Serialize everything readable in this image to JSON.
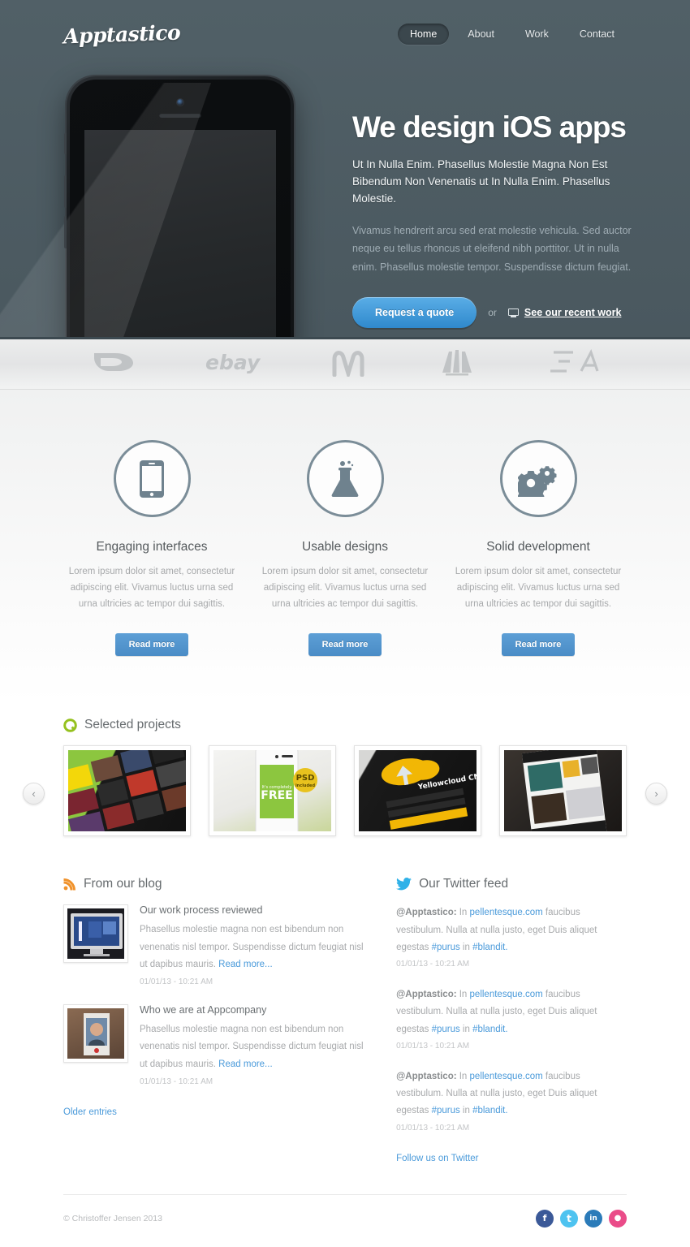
{
  "brand": {
    "logo_text": "Apptastico"
  },
  "nav": {
    "items": [
      {
        "label": "Home",
        "active": true
      },
      {
        "label": "About",
        "active": false
      },
      {
        "label": "Work",
        "active": false
      },
      {
        "label": "Contact",
        "active": false
      }
    ]
  },
  "hero": {
    "heading": "We design iOS apps",
    "lead": "Ut In Nulla Enim. Phasellus Molestie Magna Non Est Bibendum Non Venenatis ut In Nulla Enim. Phasellus Molestie.",
    "body": "Vivamus hendrerit arcu sed erat molestie vehicula. Sed auctor neque eu tellus rhoncus ut eleifend nibh porttitor. Ut in nulla enim. Phasellus molestie tempor. Suspendisse dictum feugiat.",
    "cta_primary": "Request a quote",
    "or": "or",
    "cta_secondary": "See our recent work",
    "device": "iphone-mockup"
  },
  "clients": {
    "logos": [
      {
        "name": "dc-shoes-logo"
      },
      {
        "name": "ebay-logo"
      },
      {
        "name": "mcdonalds-logo"
      },
      {
        "name": "adidas-logo"
      },
      {
        "name": "ea-logo"
      }
    ]
  },
  "features": [
    {
      "icon": "smartphone-icon",
      "title": "Engaging interfaces",
      "text": "Lorem ipsum dolor sit amet, consectetur adipiscing elit. Vivamus luctus urna sed urna ultricies ac tempor dui sagittis.",
      "button": "Read more"
    },
    {
      "icon": "flask-icon",
      "title": "Usable designs",
      "text": "Lorem ipsum dolor sit amet, consectetur adipiscing elit. Vivamus luctus urna sed urna ultricies ac tempor dui sagittis.",
      "button": "Read more"
    },
    {
      "icon": "gears-icon",
      "title": "Solid development",
      "text": "Lorem ipsum dolor sit amet, consectetur adipiscing elit. Vivamus luctus urna sed urna ultricies ac tempor dui sagittis.",
      "button": "Read more"
    }
  ],
  "projects": {
    "heading": "Selected projects",
    "heading_icon": "green-circle-icon",
    "prev_label": "‹",
    "next_label": "›",
    "items": [
      {
        "name": "music-app-thumbnail"
      },
      {
        "name": "psd-free-mockup-thumbnail"
      },
      {
        "name": "yellowcloud-cms-thumbnail"
      },
      {
        "name": "dribbble-app-thumbnail"
      }
    ]
  },
  "blog": {
    "heading": "From our blog",
    "heading_icon": "rss-icon",
    "older_entries": "Older entries",
    "posts": [
      {
        "title": "Our work process reviewed",
        "text": "Phasellus molestie magna non est bibendum non venenatis nisl tempor. Suspendisse dictum feugiat nisl ut dapibus mauris.",
        "read_more": "Read more...",
        "date": "01/01/13 - 10:21 AM",
        "thumb": "imac-screen-photo"
      },
      {
        "title": "Who we are at Appcompany",
        "text": "Phasellus molestie magna non est bibendum non venenatis nisl tempor. Suspendisse dictum feugiat nisl ut dapibus mauris.",
        "read_more": "Read more...",
        "date": "01/01/13 - 10:21 AM",
        "thumb": "portrait-photo"
      }
    ]
  },
  "twitter": {
    "heading": "Our Twitter feed",
    "heading_icon": "twitter-bird-icon",
    "follow": "Follow us on Twitter",
    "tweets": [
      {
        "handle": "@Apptastico:",
        "pre": " In ",
        "link": "pellentesque.com",
        "mid": " faucibus vestibulum. Nulla at nulla justo, eget Duis aliquet egestas ",
        "tag1": "#purus",
        "join": " in ",
        "tag2": "#blandit.",
        "date": "01/01/13 - 10:21 AM"
      },
      {
        "handle": "@Apptastico:",
        "pre": " In ",
        "link": "pellentesque.com",
        "mid": " faucibus vestibulum. Nulla at nulla justo, eget Duis aliquet egestas ",
        "tag1": "#purus",
        "join": " in ",
        "tag2": "#blandit.",
        "date": "01/01/13 - 10:21 AM"
      },
      {
        "handle": "@Apptastico:",
        "pre": " In ",
        "link": "pellentesque.com",
        "mid": " faucibus vestibulum. Nulla at nulla justo, eget Duis aliquet egestas ",
        "tag1": "#purus",
        "join": " in ",
        "tag2": "#blandit.",
        "date": "01/01/13 - 10:21 AM"
      }
    ]
  },
  "footer": {
    "copyright": "© Christoffer Jensen 2013",
    "socials": [
      {
        "name": "facebook-icon",
        "glyph": "f",
        "color": "#3b5998"
      },
      {
        "name": "twitter-icon",
        "glyph": "t",
        "color": "#4ec3f0"
      },
      {
        "name": "linkedin-icon",
        "glyph": "in",
        "color": "#2b7bb9"
      },
      {
        "name": "dribbble-icon",
        "glyph": "●",
        "color": "#ea4c89"
      }
    ]
  },
  "colors": {
    "hero_bg": "#4d5c63",
    "accent_blue": "#3f92d2",
    "link_blue": "#4a9ada",
    "icon_slate": "#7b8d98",
    "rss_orange": "#f0922b",
    "green": "#95c11f"
  }
}
